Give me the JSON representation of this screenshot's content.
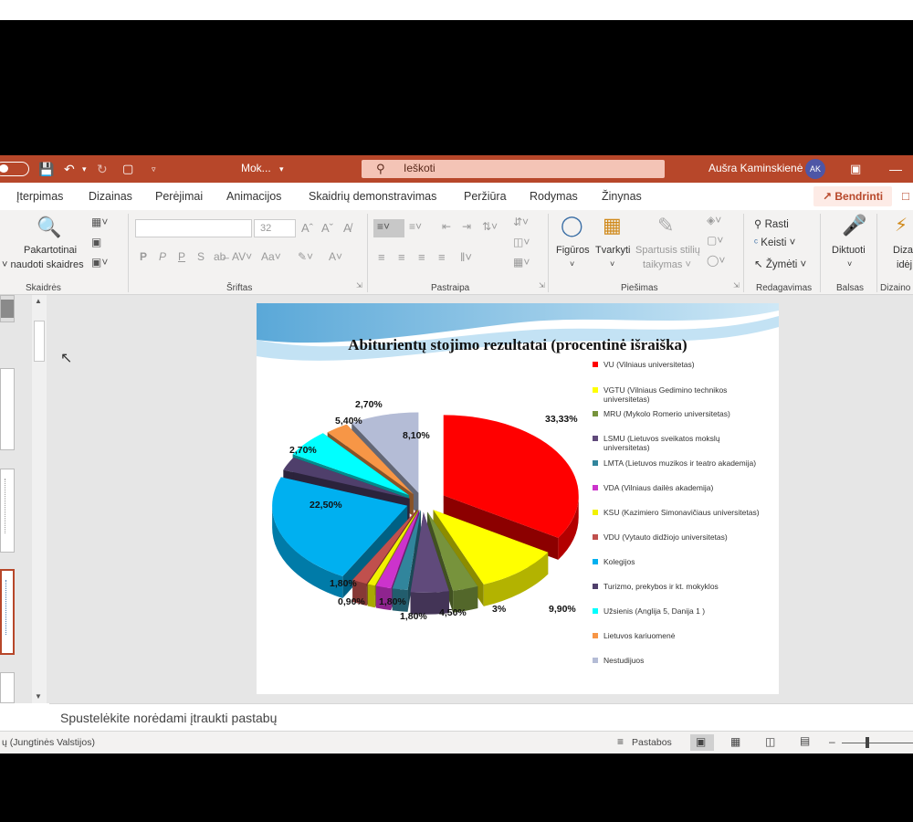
{
  "titlebar": {
    "doc_name": "Mok...",
    "search_placeholder": "Ieškoti",
    "user_name": "Aušra Kaminskienė",
    "avatar_initials": "AK"
  },
  "tabs": [
    "Įterpimas",
    "Dizainas",
    "Perėjimai",
    "Animacijos",
    "Skaidrių demonstravimas",
    "Peržiūra",
    "Rodymas",
    "Žinynas"
  ],
  "share_label": "Bendrinti",
  "ribbon": {
    "slides": {
      "reuse_line1": "Pakartotinai",
      "reuse_line2": "naudoti skaidres",
      "group": "Skaidrės"
    },
    "font": {
      "size": "32",
      "bold": "P",
      "italic": "P",
      "underline": "P",
      "strike": "S",
      "aa": "Aa",
      "group": "Šriftas"
    },
    "paragraph": {
      "group": "Pastraipa"
    },
    "drawing": {
      "shapes": "Figūros",
      "arrange": "Tvarkyti",
      "quick_styles_1": "Spartusis stilių",
      "quick_styles_2": "taikymas",
      "group": "Piešimas"
    },
    "editing": {
      "find": "Rasti",
      "replace": "Keisti",
      "select": "Žymėti",
      "group": "Redagavimas"
    },
    "voice": {
      "dictate": "Diktuoti",
      "group": "Balsas"
    },
    "design": {
      "ideas_1": "Diza",
      "ideas_2": "idėj",
      "group": "Dizaino"
    }
  },
  "notes_placeholder": "Spustelėkite norėdami įtraukti pastabų",
  "status": {
    "language": "ų (Jungtinės Valstijos)",
    "notes": "Pastabos"
  },
  "chart_data": {
    "type": "pie",
    "title": "Abiturientų stojimo rezultatai (procentinė išraiška)",
    "series": [
      {
        "name": "VU (Vilniaus universitetas)",
        "value": 33.33,
        "label": "33,33%",
        "color": "#ff0000"
      },
      {
        "name": "VGTU (Vilniaus Gedimino technikos universitetas)",
        "value": 9.9,
        "label": "9,90%",
        "color": "#ffff00"
      },
      {
        "name": "MRU (Mykolo Romerio universitetas)",
        "value": 3,
        "label": "3%",
        "color": "#77933c"
      },
      {
        "name": "LSMU (Lietuvos sveikatos mokslų universitetas)",
        "value": 4.5,
        "label": "4,50%",
        "color": "#604a7b"
      },
      {
        "name": "LMTA (Lietuvos muzikos ir teatro akademija)",
        "value": 1.8,
        "label": "1,80%",
        "color": "#31859c"
      },
      {
        "name": "VDA (Vilniaus dailės akademija)",
        "value": 1.8,
        "label": "1,80%",
        "color": "#cc33cc"
      },
      {
        "name": "KSU (Kazimiero Simonavičiaus universitetas)",
        "value": 0.9,
        "label": "0,90%",
        "color": "#f2f200"
      },
      {
        "name": "VDU (Vytauto didžiojo universitetas)",
        "value": 1.8,
        "label": "1,80%",
        "color": "#c0504d"
      },
      {
        "name": "Kolegijos",
        "value": 22.5,
        "label": "22,50%",
        "color": "#00b0f0"
      },
      {
        "name": "Turizmo, prekybos ir kt. mokyklos",
        "value": 2.7,
        "label": "2,70%",
        "color": "#4f3f6b"
      },
      {
        "name": "Užsienis (Anglija 5, Danija 1 )",
        "value": 5.4,
        "label": "5,40%",
        "color": "#00ffff"
      },
      {
        "name": "Lietuvos kariuomenė",
        "value": 2.7,
        "label": "2,70%",
        "color": "#f79646"
      },
      {
        "name": "Nestudijuos",
        "value": 8.1,
        "label": "8,10%",
        "color": "#b4bcd6"
      }
    ],
    "legend_position": "right"
  }
}
